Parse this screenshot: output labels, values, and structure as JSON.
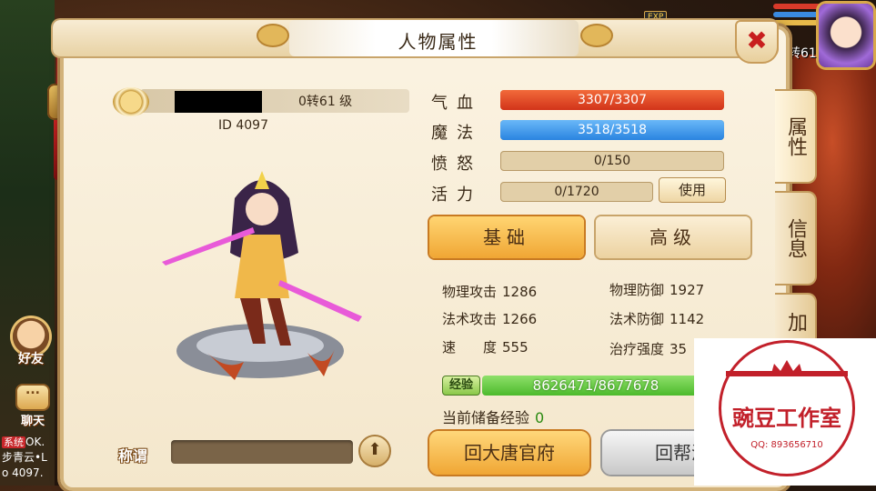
{
  "panel": {
    "title": "人物属性",
    "close_icon": "✖"
  },
  "hud": {
    "exp_tag": "EXP",
    "side_level": "转61",
    "friend_label": "好友",
    "chat_label": "聊天",
    "chat_lines": [
      "系统",
      "OK.",
      "步青云•L",
      "o 4097."
    ]
  },
  "side_tabs": [
    "属性",
    "信息",
    "加"
  ],
  "profile": {
    "level": "0转61 级",
    "id_line": "ID 4097",
    "title_label": "称谓"
  },
  "stats": {
    "hp": {
      "label": "气血",
      "value": "3307/3307",
      "ratio": 1.0
    },
    "mp": {
      "label": "魔法",
      "value": "3518/3518",
      "ratio": 1.0
    },
    "rage": {
      "label": "愤怒",
      "value": "0/150",
      "ratio": 0
    },
    "vitality": {
      "label": "活力",
      "value": "0/1720",
      "ratio": 0
    },
    "use_button": "使用"
  },
  "tabs": {
    "basic": "基础",
    "advanced": "高级"
  },
  "attributes": {
    "phys_atk": {
      "label": "物理攻击",
      "value": "1286"
    },
    "phys_def": {
      "label": "物理防御",
      "value": "1927"
    },
    "mag_atk": {
      "label": "法术攻击",
      "value": "1266"
    },
    "mag_def": {
      "label": "法术防御",
      "value": "1142"
    },
    "speed": {
      "label": "速　　度",
      "value": "555"
    },
    "heal": {
      "label": "治疗强度",
      "value": "35"
    }
  },
  "experience": {
    "badge": "经验",
    "value": "8626471/8677678",
    "ratio": 0.994,
    "reserve_label": "当前储备经验",
    "reserve_value": "0"
  },
  "actions": {
    "return_tang": "回大唐官府",
    "return_gang": "回帮派"
  },
  "watermark": {
    "studio": "豌豆工作室",
    "qq": "QQ: 893656710"
  },
  "colors": {
    "accent": "#f0a634",
    "hp": "#d2341a",
    "mp": "#2a84e0",
    "exp": "#4cba2c",
    "close": "#c81e1e"
  }
}
